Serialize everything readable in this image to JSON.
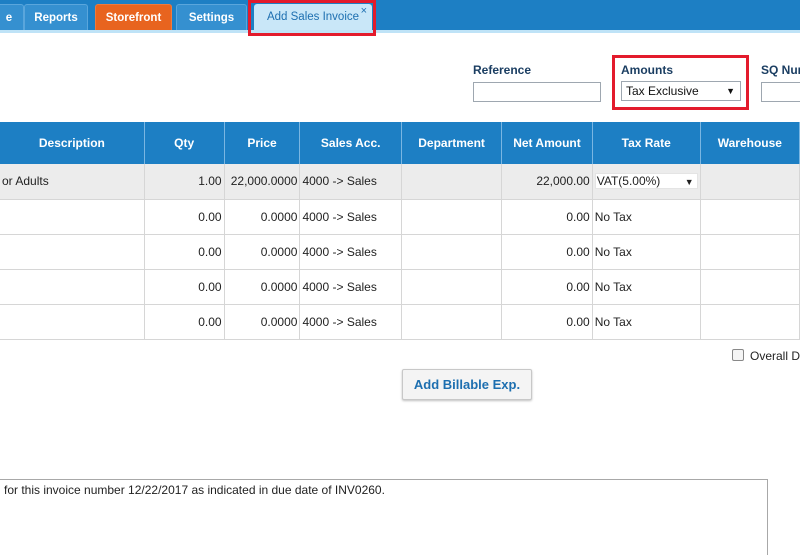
{
  "nav": {
    "tabs": [
      {
        "label": "e"
      },
      {
        "label": "Reports"
      },
      {
        "label": "Storefront"
      },
      {
        "label": "Settings"
      },
      {
        "label": "Add Sales Invoice",
        "close": "×"
      }
    ]
  },
  "form": {
    "reference_label": "Reference",
    "reference_value": "",
    "amounts_label": "Amounts",
    "amounts_value": "Tax Exclusive",
    "sq_label": "SQ Nur"
  },
  "grid": {
    "headers": [
      "Description",
      "Qty",
      "Price",
      "Sales Acc.",
      "Department",
      "Net Amount",
      "Tax Rate",
      "Warehouse"
    ],
    "rows": [
      {
        "description": "or Adults",
        "qty": "1.00",
        "price": "22,000.0000",
        "sales_acc": "4000 -> Sales",
        "department": "",
        "net_amount": "22,000.00",
        "tax_rate": "VAT(5.00%)",
        "warehouse": ""
      },
      {
        "description": "",
        "qty": "0.00",
        "price": "0.0000",
        "sales_acc": "4000 -> Sales",
        "department": "",
        "net_amount": "0.00",
        "tax_rate": "No Tax",
        "warehouse": ""
      },
      {
        "description": "",
        "qty": "0.00",
        "price": "0.0000",
        "sales_acc": "4000 -> Sales",
        "department": "",
        "net_amount": "0.00",
        "tax_rate": "No Tax",
        "warehouse": ""
      },
      {
        "description": "",
        "qty": "0.00",
        "price": "0.0000",
        "sales_acc": "4000 -> Sales",
        "department": "",
        "net_amount": "0.00",
        "tax_rate": "No Tax",
        "warehouse": ""
      },
      {
        "description": "",
        "qty": "0.00",
        "price": "0.0000",
        "sales_acc": "4000 -> Sales",
        "department": "",
        "net_amount": "0.00",
        "tax_rate": "No Tax",
        "warehouse": ""
      }
    ]
  },
  "overall_discount_label": "Overall D",
  "add_billable_label": "Add Billable Exp.",
  "notes_text": "for this invoice number 12/22/2017 as indicated in due date of INV0260.",
  "icons": {
    "dropdown": "▼",
    "checkbox": "checkbox-icon"
  },
  "colors": {
    "nav": "#1d7fc4",
    "orange_tab": "#e8641f",
    "active_tab": "#c9e7f8",
    "highlight": "#e31b2c",
    "link_text": "#1d6fb0"
  }
}
